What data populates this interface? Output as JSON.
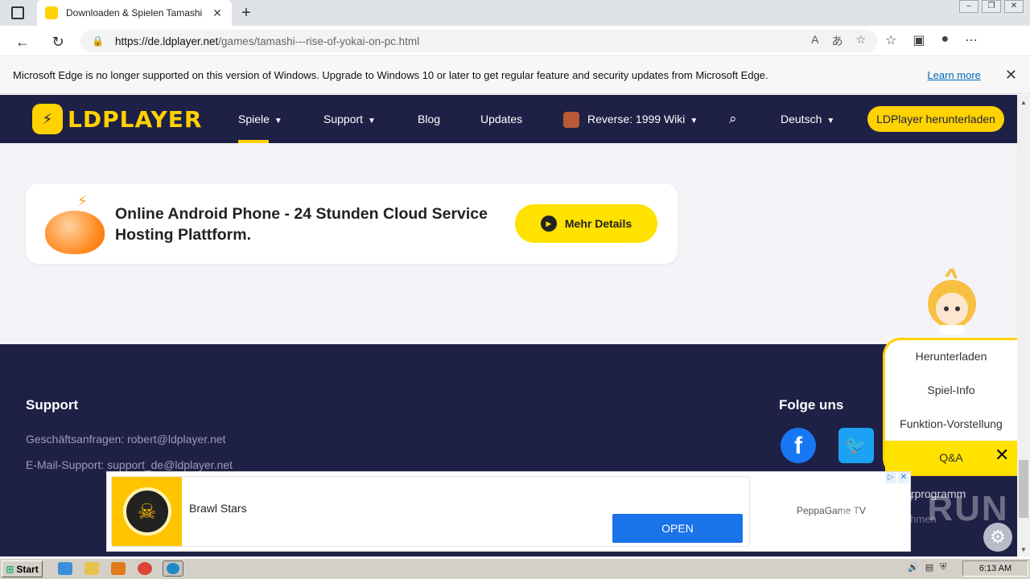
{
  "browser": {
    "tab_title": "Downloaden & Spielen Tamashi",
    "new_tab": "+",
    "url_host": "https://de.ldplayer.net",
    "url_path": "/games/tamashi---rise-of-yokai-on-pc.html"
  },
  "infobar": {
    "message": "Microsoft Edge is no longer supported on this version of Windows. Upgrade to Windows 10 or later to get regular feature and security updates from Microsoft Edge.",
    "learn_more": "Learn more"
  },
  "nav": {
    "logo_text": "LDPLAYER",
    "items": [
      "Spiele",
      "Support",
      "Blog",
      "Updates"
    ],
    "game_link": "Reverse: 1999 Wiki",
    "language": "Deutsch",
    "download": "LDPlayer herunterladen"
  },
  "promo": {
    "headline": "Online Android Phone - 24 Stunden Cloud Service Hosting Plattform.",
    "button": "Mehr Details"
  },
  "footer": {
    "support_heading": "Support",
    "business": "Geschäftsanfragen: robert@ldplayer.net",
    "email": "E-Mail-Support: support_de@ldplayer.net",
    "follow_heading": "Folge uns",
    "partner_prefix": "erprogramm",
    "partner_sub": "ehmen"
  },
  "side_menu": {
    "items": [
      "Herunterladen",
      "Spiel-Info",
      "Funktion-Vorstellung",
      "Q&A"
    ]
  },
  "ad": {
    "app_name": "Brawl Stars",
    "open_button": "OPEN",
    "sponsor": "PeppaGame TV"
  },
  "watermark": "ANY RUN",
  "taskbar": {
    "start": "Start",
    "clock": "6:13 AM"
  },
  "colors": {
    "brand_yellow": "#ffd200",
    "navy": "#1f2046",
    "ad_blue": "#1a73e8"
  }
}
